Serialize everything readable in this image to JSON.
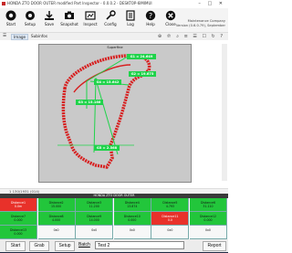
{
  "window": {
    "title": "HONDA ZTO DOOR OUTER modified Part Inspector - 0.0.0.2 - DESKTOP-6IMIMUI",
    "controls": "– □ ✕"
  },
  "toolbar": {
    "items": [
      {
        "label": "Start",
        "icon": "start-icon"
      },
      {
        "label": "Setup",
        "icon": "gear-icon"
      },
      {
        "label": "Save",
        "icon": "download-icon"
      },
      {
        "label": "Snapshot",
        "icon": "camera-icon"
      },
      {
        "label": "Inspect",
        "icon": "inspect-icon"
      },
      {
        "label": "Config",
        "icon": "config-icon"
      },
      {
        "label": "Log",
        "icon": "log-icon"
      },
      {
        "label": "Help",
        "icon": "help-icon"
      },
      {
        "label": "Close",
        "icon": "close-icon"
      }
    ],
    "info_line1": "Maintenance Company",
    "info_line2": "Version (0.6.0.79), September"
  },
  "viewbar": {
    "tab1": "Image",
    "tab2": "Subinfos",
    "icons": "⊕ ℗ ⌕ ≡ ☰ ☐ ↻ ?"
  },
  "image": {
    "panel_title": "Superfine",
    "labels": {
      "g1": "G1 = 24.649",
      "g2": "G2 = 19.675",
      "g3": "G3 = 15.166",
      "g4": "G4 = 15.642",
      "g5": "G5 = 2.568"
    },
    "status": "1 130/1931 (014)"
  },
  "results": {
    "title": "HONDA ZTO DOOR OUTER",
    "rows": [
      [
        {
          "name": "Distance1",
          "value": "0.0m",
          "status": "red"
        },
        {
          "name": "Distance2",
          "value": "15.000",
          "status": "green"
        },
        {
          "name": "Distance3",
          "value": "11.200",
          "status": "green"
        },
        {
          "name": "Distance4",
          "value": "13.874",
          "status": "green"
        },
        {
          "name": "Distance5",
          "value": "4.793",
          "status": "green"
        },
        {
          "name": "Distance6",
          "value": "31.110",
          "status": "green"
        }
      ],
      [
        {
          "name": "Distance7",
          "value": "0.000",
          "status": "green"
        },
        {
          "name": "Distance8",
          "value": "4.000",
          "status": "green"
        },
        {
          "name": "Distance9",
          "value": "14.000",
          "status": "green"
        },
        {
          "name": "Distance10",
          "value": "0.000",
          "status": "green"
        },
        {
          "name": "Distance11",
          "value": "0.0",
          "status": "red"
        },
        {
          "name": "Distance12",
          "value": "0.000",
          "status": "green"
        }
      ],
      [
        {
          "name": "Distance13",
          "value": "0.000",
          "status": "green"
        },
        {
          "name": "",
          "value": "0x0",
          "status": "white"
        },
        {
          "name": "",
          "value": "0x0",
          "status": "white"
        },
        {
          "name": "",
          "value": "0x0",
          "status": "white"
        },
        {
          "name": "",
          "value": "0x0",
          "status": "white"
        },
        {
          "name": "",
          "value": "0x0",
          "status": "white"
        }
      ]
    ]
  },
  "bottom": {
    "start": "Start",
    "grab": "Grab",
    "setup": "Setup",
    "batch_label": "Batch",
    "batch_value": "Test 2",
    "report": "Report"
  },
  "colors": {
    "pass": "#22c63b",
    "fail": "#e8312a",
    "overlay": "#1fd34a",
    "trace": "#d71f1f"
  }
}
